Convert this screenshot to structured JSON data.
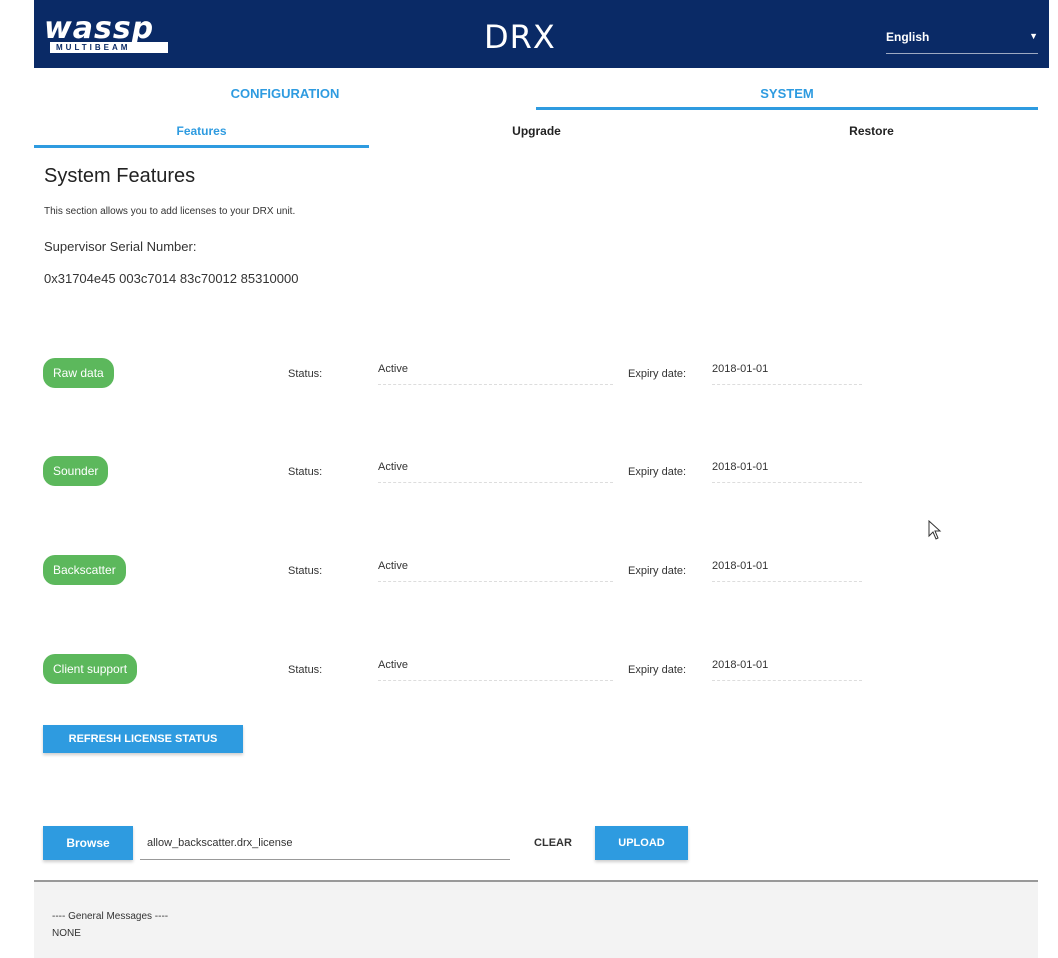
{
  "header": {
    "logo_main": "wassp",
    "logo_sub": "MULTIBEAM",
    "product": "DRX",
    "language": {
      "selected": "English"
    }
  },
  "tabs": [
    {
      "label": "CONFIGURATION",
      "active": false
    },
    {
      "label": "SYSTEM",
      "active": true
    }
  ],
  "subtabs": [
    {
      "label": "Features",
      "active": true
    },
    {
      "label": "Upgrade",
      "active": false
    },
    {
      "label": "Restore",
      "active": false
    }
  ],
  "features_page": {
    "title": "System Features",
    "description": "This section allows you to add licenses to your DRX unit.",
    "serial_label": "Supervisor Serial Number:",
    "serial_value": "0x31704e45 003c7014 83c70012 85310000",
    "status_label": "Status:",
    "expiry_label": "Expiry date:",
    "features": [
      {
        "name": "Raw data",
        "status": "Active",
        "expiry": "2018-01-01"
      },
      {
        "name": "Sounder",
        "status": "Active",
        "expiry": "2018-01-01"
      },
      {
        "name": "Backscatter",
        "status": "Active",
        "expiry": "2018-01-01"
      },
      {
        "name": "Client support",
        "status": "Active",
        "expiry": "2018-01-01"
      }
    ],
    "refresh_label": "REFRESH LICENSE STATUS",
    "browse_label": "Browse",
    "file_value": "allow_backscatter.drx_license",
    "clear_label": "CLEAR",
    "upload_label": "UPLOAD"
  },
  "messages": {
    "title": "---- General Messages ----",
    "body": "NONE"
  },
  "colors": {
    "header_bg": "#0a2a66",
    "accent": "#2e9be0",
    "active_pill": "#5cb85c"
  }
}
